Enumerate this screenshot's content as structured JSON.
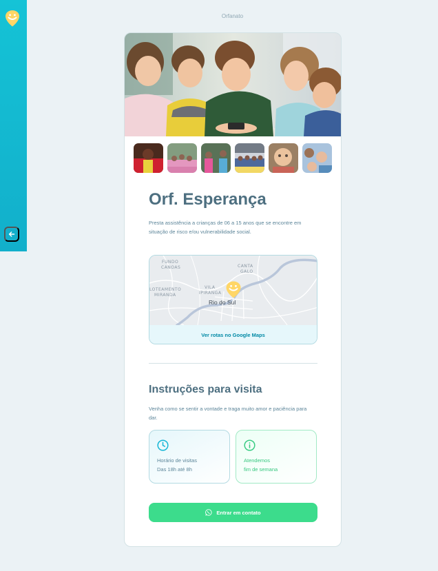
{
  "header": {
    "title": "Orfanato"
  },
  "sidebar": {
    "logo_icon": "happy-face-marker-icon",
    "back_icon": "arrow-left-icon"
  },
  "orphanage": {
    "name": "Orf. Esperança",
    "description": "Presta assistência a crianças de 06 a 15 anos que se encontre em situação de risco e/ou vulnerabilidade social.",
    "thumbnail_count": 6
  },
  "map": {
    "labels": {
      "fundo_1": "FUNDO",
      "fundo_2": "CANOAS",
      "canta_1": "CANTA",
      "canta_2": "GALO",
      "lot_1": "LOTEAMENTO",
      "lot_2": "MIRANDA",
      "vila_1": "VILA",
      "vila_2": "IPIRANGA",
      "city": "Rio do Sul"
    },
    "link_label": "Ver rotas no Google Maps"
  },
  "instructions": {
    "title": "Instruções para visita",
    "text": "Venha como se sentir a vontade e traga muito amor e paciência para dar.",
    "hours": {
      "line1": "Horário de visitas",
      "line2": "Das 18h até 8h",
      "icon": "clock-icon"
    },
    "open": {
      "line1": "Atendemos",
      "line2": "fim de semana",
      "icon": "info-icon"
    }
  },
  "contact_button": {
    "label": "Entrar em contato",
    "icon": "whatsapp-icon"
  },
  "colors": {
    "sidebar": "#15c3d6",
    "title": "#4d6f80",
    "text": "#5c8599",
    "green": "#3cdc8c",
    "marker": "#ffd666"
  }
}
